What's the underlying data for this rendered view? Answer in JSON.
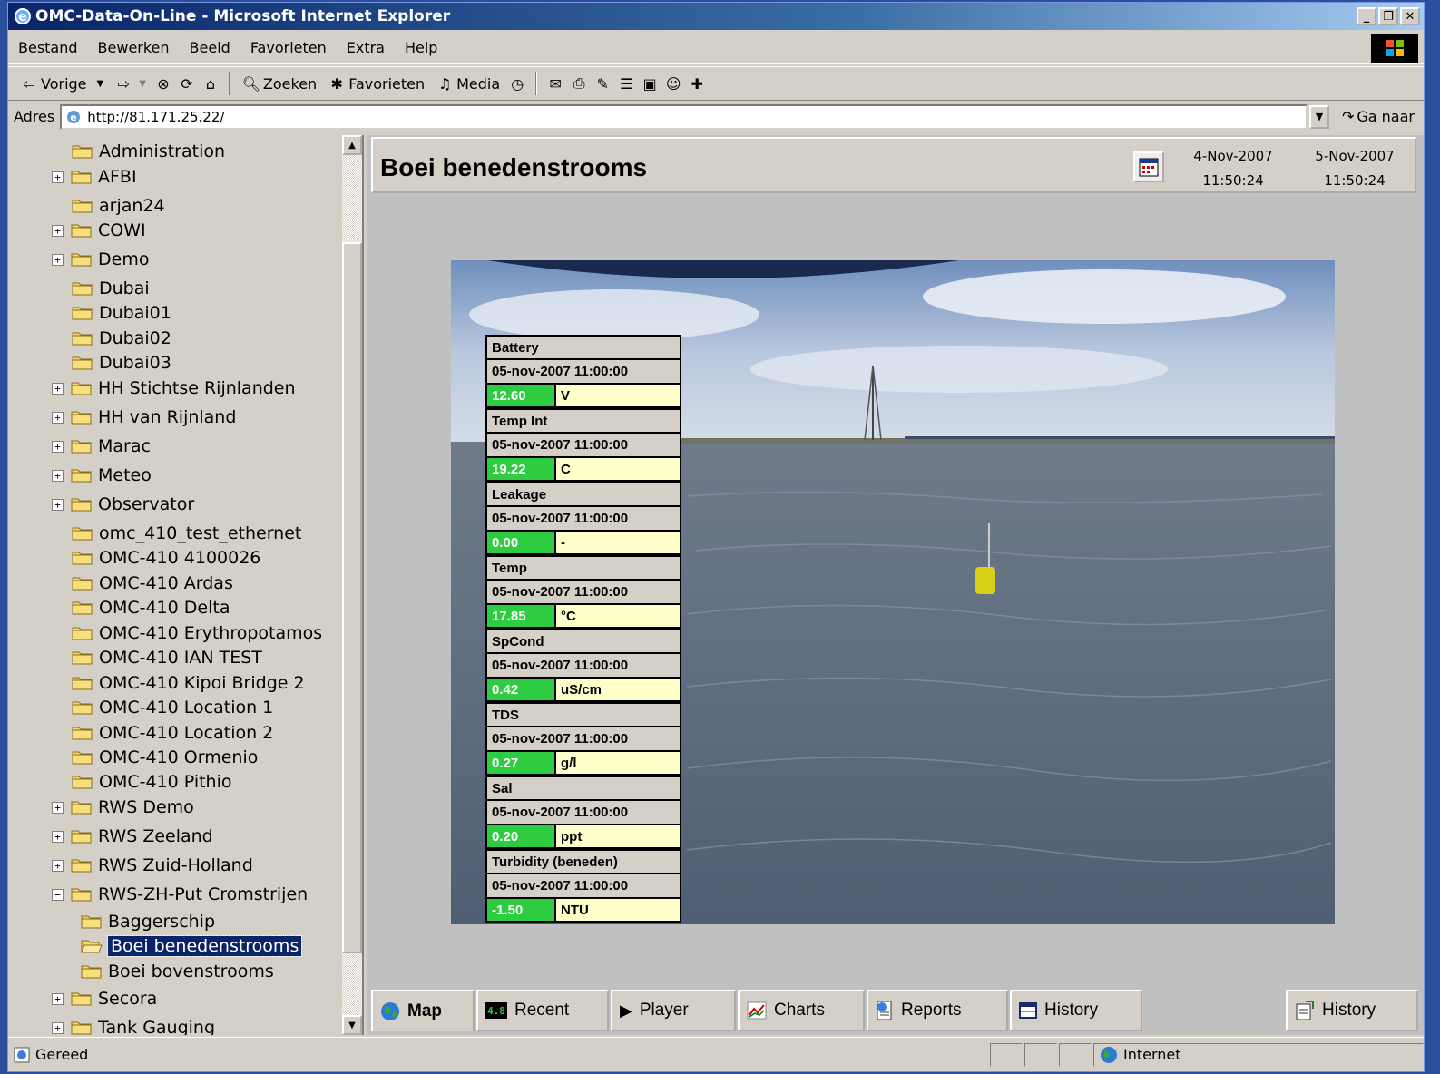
{
  "window": {
    "title": "OMC-Data-On-Line - Microsoft Internet Explorer"
  },
  "menubar": [
    "Bestand",
    "Bewerken",
    "Beeld",
    "Favorieten",
    "Extra",
    "Help"
  ],
  "toolbar": {
    "back": "Vorige",
    "search": "Zoeken",
    "favorites": "Favorieten",
    "media": "Media"
  },
  "address": {
    "label": "Adres",
    "url": "http://81.171.25.22/",
    "go": "Ga naar"
  },
  "tree": [
    {
      "label": "Administration",
      "expander": ""
    },
    {
      "label": "AFBI",
      "expander": "+"
    },
    {
      "label": "arjan24",
      "expander": ""
    },
    {
      "label": "COWI",
      "expander": "+"
    },
    {
      "label": "Demo",
      "expander": "+"
    },
    {
      "label": "Dubai",
      "expander": ""
    },
    {
      "label": "Dubai01",
      "expander": ""
    },
    {
      "label": "Dubai02",
      "expander": ""
    },
    {
      "label": "Dubai03",
      "expander": ""
    },
    {
      "label": "HH Stichtse Rijnlanden",
      "expander": "+"
    },
    {
      "label": "HH van Rijnland",
      "expander": "+"
    },
    {
      "label": "Marac",
      "expander": "+"
    },
    {
      "label": "Meteo",
      "expander": "+"
    },
    {
      "label": "Observator",
      "expander": "+"
    },
    {
      "label": "omc_410_test_ethernet",
      "expander": ""
    },
    {
      "label": "OMC-410 4100026",
      "expander": ""
    },
    {
      "label": "OMC-410 Ardas",
      "expander": ""
    },
    {
      "label": "OMC-410 Delta",
      "expander": ""
    },
    {
      "label": "OMC-410 Erythropotamos",
      "expander": ""
    },
    {
      "label": "OMC-410 IAN TEST",
      "expander": ""
    },
    {
      "label": "OMC-410 Kipoi Bridge 2",
      "expander": ""
    },
    {
      "label": "OMC-410 Location 1",
      "expander": ""
    },
    {
      "label": "OMC-410 Location 2",
      "expander": ""
    },
    {
      "label": "OMC-410 Ormenio",
      "expander": ""
    },
    {
      "label": "OMC-410 Pithio",
      "expander": ""
    },
    {
      "label": "RWS Demo",
      "expander": "+"
    },
    {
      "label": "RWS Zeeland",
      "expander": "+"
    },
    {
      "label": "RWS Zuid-Holland",
      "expander": "+"
    },
    {
      "label": "RWS-ZH-Put Cromstrijen",
      "expander": "−"
    },
    {
      "label": "Baggerschip",
      "expander": "",
      "child": true
    },
    {
      "label": "Boei benedenstrooms",
      "expander": "",
      "child": true,
      "selected": true
    },
    {
      "label": "Boei bovenstrooms",
      "expander": "",
      "child": true
    },
    {
      "label": "Secora",
      "expander": "+"
    },
    {
      "label": "Tank Gauging",
      "expander": "+"
    }
  ],
  "main": {
    "title": "Boei benedenstrooms",
    "from_date": "4-Nov-2007",
    "from_time": "11:50:24",
    "to_date": "5-Nov-2007",
    "to_time": "11:50:24"
  },
  "readings": [
    {
      "name": "Battery",
      "time": "05-nov-2007 11:00:00",
      "value": "12.60",
      "unit": "V"
    },
    {
      "name": "Temp Int",
      "time": "05-nov-2007 11:00:00",
      "value": "19.22",
      "unit": "C"
    },
    {
      "name": "Leakage",
      "time": "05-nov-2007 11:00:00",
      "value": "0.00",
      "unit": "-"
    },
    {
      "name": "Temp",
      "time": "05-nov-2007 11:00:00",
      "value": "17.85",
      "unit": "°C"
    },
    {
      "name": "SpCond",
      "time": "05-nov-2007 11:00:00",
      "value": "0.42",
      "unit": "uS/cm"
    },
    {
      "name": "TDS",
      "time": "05-nov-2007 11:00:00",
      "value": "0.27",
      "unit": "g/l"
    },
    {
      "name": "Sal",
      "time": "05-nov-2007 11:00:00",
      "value": "0.20",
      "unit": "ppt"
    },
    {
      "name": "Turbidity (beneden)",
      "time": "05-nov-2007 11:00:00",
      "value": "-1.50",
      "unit": "NTU"
    }
  ],
  "tabs": [
    {
      "label": "Map",
      "icon": "globe-icon"
    },
    {
      "label": "Recent",
      "icon": "lcd-icon"
    },
    {
      "label": "Player",
      "icon": "play-icon"
    },
    {
      "label": "Charts",
      "icon": "chart-icon"
    },
    {
      "label": "Reports",
      "icon": "report-icon"
    },
    {
      "label": "History",
      "icon": "table-icon"
    },
    {
      "label": "History",
      "icon": "export-icon"
    }
  ],
  "status": {
    "text": "Gereed",
    "zone": "Internet"
  }
}
